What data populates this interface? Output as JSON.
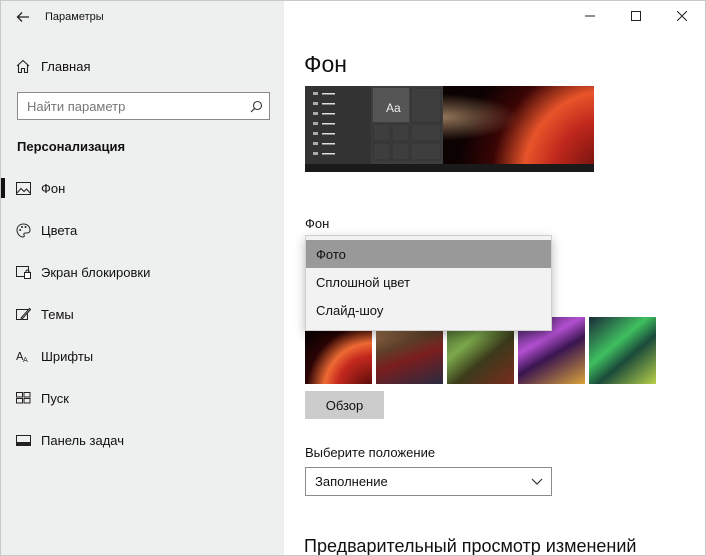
{
  "window": {
    "title": "Параметры",
    "controls": {
      "minimize_icon": "minimize-icon",
      "maximize_icon": "maximize-icon",
      "close_icon": "close-icon"
    }
  },
  "sidebar": {
    "home_label": "Главная",
    "search_placeholder": "Найти параметр",
    "section": "Персонализация",
    "items": [
      {
        "label": "Фон",
        "icon": "picture-icon",
        "active": true
      },
      {
        "label": "Цвета",
        "icon": "palette-icon",
        "active": false
      },
      {
        "label": "Экран блокировки",
        "icon": "lock-screen-icon",
        "active": false
      },
      {
        "label": "Темы",
        "icon": "themes-icon",
        "active": false
      },
      {
        "label": "Шрифты",
        "icon": "fonts-icon",
        "active": false
      },
      {
        "label": "Пуск",
        "icon": "start-icon",
        "active": false
      },
      {
        "label": "Панель задач",
        "icon": "taskbar-icon",
        "active": false
      }
    ]
  },
  "main": {
    "title": "Фон",
    "preview_sample_text": "Aa",
    "background_label": "Фон",
    "background_options": [
      "Фото",
      "Сплошной цвет",
      "Слайд-шоу"
    ],
    "background_selected": "Фото",
    "browse_label": "Обзор",
    "fit_label": "Выберите положение",
    "fit_value": "Заполнение",
    "preview_changes_heading": "Предварительный просмотр изменений"
  }
}
